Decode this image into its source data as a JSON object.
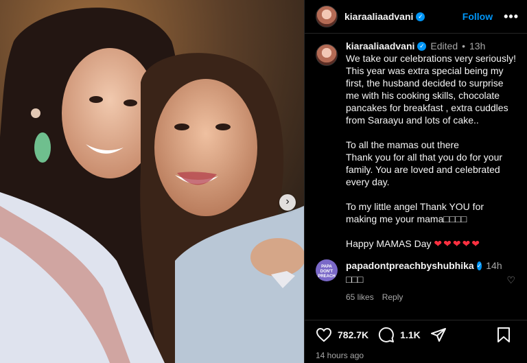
{
  "post": {
    "username": "kiaraaliaadvani",
    "follow_label": "Follow",
    "more_label": "•••"
  },
  "caption": {
    "username": "kiaraaliaadvani",
    "edited": "Edited",
    "dot": "•",
    "time": "13h",
    "text": "We take our celebrations very seriously! This year was extra special being my first, the husband decided to surprise me with his cooking skills, chocolate pancakes for breakfast , extra cuddles from Saraayu and lots of cake..\n\nTo all the mamas out there\nThank you for all that you do for your family. You are loved and celebrated every day.\n\nTo my little angel Thank YOU for making me your mama□□□□\n\nHappy MAMAS Day ",
    "hearts": "❤❤❤❤❤"
  },
  "comment": {
    "username": "papadontpreachbyshubhika",
    "time": "14h",
    "text": "□□□",
    "likes": "65 likes",
    "reply": "Reply",
    "avatar_text": "PAPA DON'T PREACH"
  },
  "footer": {
    "likes": "782.7K",
    "comments": "1.1K",
    "time_ago": "14 hours ago"
  },
  "colors": {
    "accent": "#0095f6",
    "heart": "#ff3040",
    "background": "#000000"
  },
  "icons": [
    "verified-icon",
    "heart-icon",
    "comment-icon",
    "share-icon",
    "bookmark-icon",
    "chevron-right-icon"
  ]
}
